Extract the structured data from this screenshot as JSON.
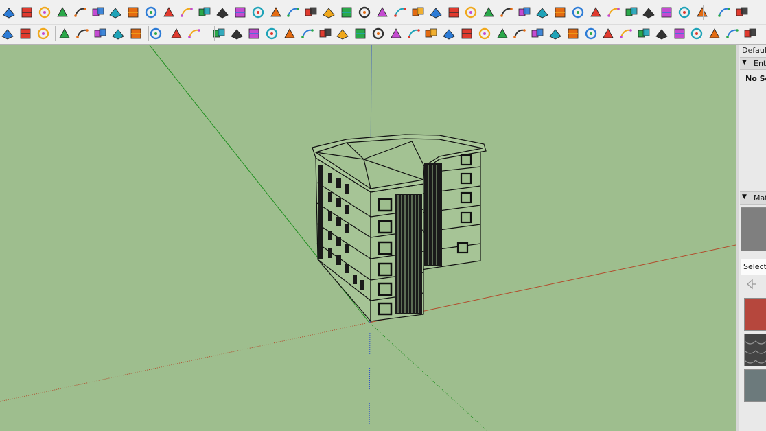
{
  "toolbar_top": {
    "icons": [
      "paint-bucket-blue-icon",
      "paint-bucket-cyan-icon",
      "layer-yellow-icon",
      "layer-green-icon",
      "layer-red-icon",
      "layer-outline-icon",
      "rotate-orange-icon",
      "red-square-icon",
      "table-grid-icon",
      "flag-icon",
      "box-tool-icon",
      "chain-link-icon",
      "curve-line-icon",
      "dotted-path-icon",
      "red-cross-icon",
      "green-cross-icon",
      "blue-x-icon",
      "triangle-green-icon",
      "triangle-multi-icon",
      "warning-triangle-icon",
      "hook-yellow-icon",
      "flame-orange-icon",
      "rotate-arrow-icon",
      "four-arrows-icon",
      "cylinder-icon",
      "undo-arc-icon",
      "green-shapes-icon",
      "cube-flip-icon",
      "red-cube-icon",
      "cube-split-icon",
      "red-diamond-icon",
      "frame-icon",
      "image-landscape-icon",
      "orange-grid-icon",
      "yellow-grid-icon",
      "orange-grid-alt-icon",
      "scatter-x-icon",
      "arc-points-icon",
      "component-grid-icon",
      "book-icon",
      "window-cascade-icon",
      "window-extra-icon"
    ]
  },
  "toolbar_bottom": {
    "icons": [
      "followme-icon",
      "refresh-green-icon",
      "video-camera-icon",
      "add-circle-icon",
      "tree-icon",
      "ramp-icon",
      "checker-sphere-icon",
      "cloud-upload-icon",
      "settings-gear-icon",
      "mail-icon",
      "info-icon",
      "curve-1-icon",
      "curve-2-icon",
      "curve-3-icon",
      "curve-4-icon",
      "curve-5-icon",
      "curve-6-icon",
      "curve-7-icon",
      "curve-8-icon",
      "curve-9-icon",
      "curve-10-icon",
      "curve-11-icon",
      "curve-12-icon",
      "curve-13-icon",
      "curve-14-icon",
      "curve-15-icon",
      "curve-16-icon",
      "curve-17-icon",
      "curve-18-icon",
      "curve-19-icon",
      "curve-20-icon",
      "curve-21-icon",
      "curve-22-icon",
      "curve-23-icon",
      "curve-24-icon",
      "curve-25-icon",
      "curve-26-icon",
      "curve-27-icon",
      "curve-28-icon",
      "curve-29-icon",
      "curve-30-icon",
      "curve-31-icon",
      "curve-32-icon"
    ]
  },
  "tray": {
    "title": "Default Tray",
    "entity_info": {
      "header": "Entity Info",
      "status": "No Selection"
    },
    "materials": {
      "header": "Materials",
      "select_tab": "Select"
    }
  },
  "colors": {
    "viewport_bg": "#9ebe8e",
    "toolbar_bg": "#f0f0f0",
    "axis_red": "#b24a2a",
    "axis_green": "#1f8f1f",
    "axis_blue": "#2b4cc9",
    "material_brick": "#b6473d",
    "material_roof_tile": "#444444",
    "material_stone": "#6c7a7c",
    "material_preview": "#7f7f7f"
  }
}
